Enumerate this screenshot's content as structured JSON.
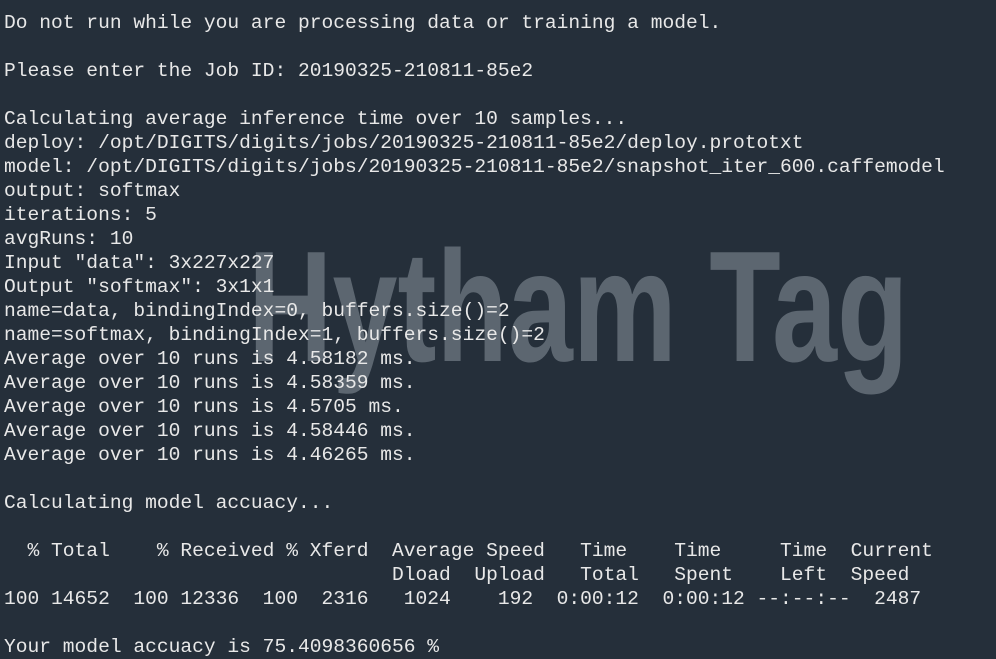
{
  "watermark": "Hytham Tag",
  "colors": {
    "background": "#252f3a",
    "text": "#e8e8e8",
    "watermark": "#5c6670"
  },
  "terminal": {
    "lines": [
      "Do not run while you are processing data or training a model.",
      "",
      "Please enter the Job ID: 20190325-210811-85e2",
      "",
      "Calculating average inference time over 10 samples...",
      "deploy: /opt/DIGITS/digits/jobs/20190325-210811-85e2/deploy.prototxt",
      "model: /opt/DIGITS/digits/jobs/20190325-210811-85e2/snapshot_iter_600.caffemodel",
      "output: softmax",
      "iterations: 5",
      "avgRuns: 10",
      "Input \"data\": 3x227x227",
      "Output \"softmax\": 3x1x1",
      "name=data, bindingIndex=0, buffers.size()=2",
      "name=softmax, bindingIndex=1, buffers.size()=2",
      "Average over 10 runs is 4.58182 ms.",
      "Average over 10 runs is 4.58359 ms.",
      "Average over 10 runs is 4.5705 ms.",
      "Average over 10 runs is 4.58446 ms.",
      "Average over 10 runs is 4.46265 ms.",
      "",
      "Calculating model accuacy...",
      "",
      "  % Total    % Received % Xferd  Average Speed   Time    Time     Time  Current",
      "                                 Dload  Upload   Total   Spent    Left  Speed",
      "100 14652  100 12336  100  2316   1024    192  0:00:12  0:00:12 --:--:--  2487",
      "",
      "Your model accuacy is 75.4098360656 %"
    ]
  }
}
